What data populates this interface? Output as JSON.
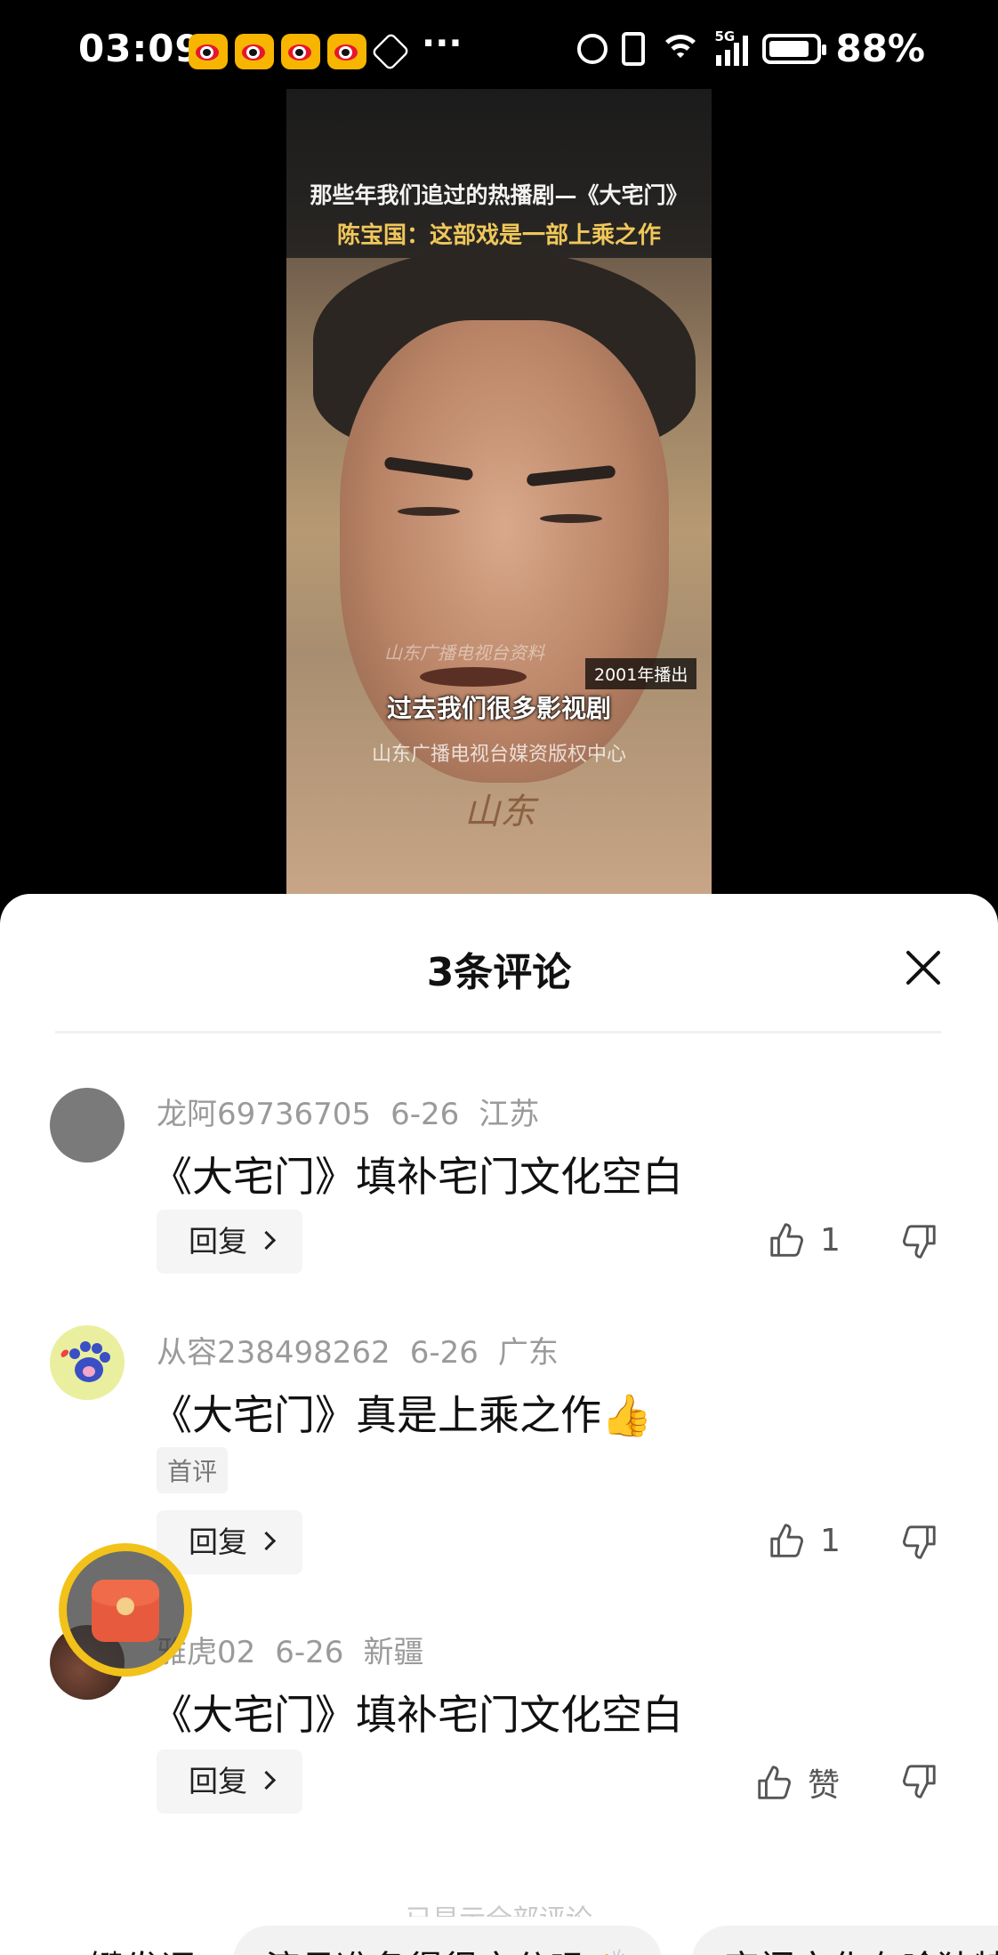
{
  "status_bar": {
    "time": "03:09",
    "more": "···",
    "network": "5G",
    "battery": "88%"
  },
  "video": {
    "title_line1": "那些年我们追过的热播剧—《大宅门》",
    "title_line2": "陈宝国：这部戏是一部上乘之作",
    "watermark": "山东广播电视台资料",
    "year_tag": "2001年播出",
    "subtitle": "过去我们很多影视剧",
    "copyright": "山东广播电视台媒资版权中心"
  },
  "comments_sheet": {
    "title": "3条评论",
    "close_icon": "close-icon",
    "comments": [
      {
        "user": "龙阿69736705",
        "date": "6-26",
        "location": "江苏",
        "text": "《大宅门》填补宅门文化空白",
        "reply_label": "回复",
        "likes": "1"
      },
      {
        "user": "从容238498262",
        "date": "6-26",
        "location": "广东",
        "text": "《大宅门》真是上乘之作👍",
        "badge": "首评",
        "reply_label": "回复",
        "likes": "1"
      },
      {
        "user": "雅虎02",
        "date": "6-26",
        "location": "新疆",
        "text": "《大宅门》填补宅门文化空白",
        "reply_label": "回复",
        "likes": "赞"
      }
    ],
    "more_hint": "已显示全部评论",
    "quick_chips": [
      "键发评",
      "演员准备得很充分吗👏",
      "宅门文化有啥独特"
    ]
  },
  "colors": {
    "accent_ring": "#f2c21a",
    "red_packet": "#e85a3d",
    "meta_text": "#9a9a9a"
  }
}
